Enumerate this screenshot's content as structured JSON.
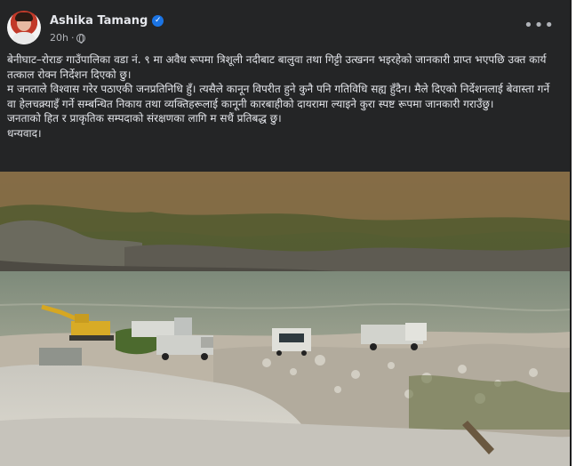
{
  "post": {
    "author": "Ashika Tamang",
    "time": "20h",
    "separator": "·",
    "more_label": "•••",
    "verified_glyph": "✓",
    "paragraphs": [
      "बेनीघाट–रोराङ गाउँपालिका वडा नं. ९ मा अवैध रूपमा त्रिशूली नदीबाट बालुवा तथा गिट्टी उत्खनन भइरहेको जानकारी प्राप्त भएपछि उक्त कार्य तत्काल रोक्न निर्देशन दिएको छु।",
      "म जनताले विश्वास गरेर पठाएकी जनप्रतिनिधि हुँ। त्यसैले कानून विपरीत हुने कुनै पनि गतिविधि सह्य हुँदैन। मैले दिएको निर्देशनलाई बेवास्ता गर्ने वा हेलचक्र्याइँ गर्ने सम्बन्धित निकाय तथा व्यक्तिहरूलाई कानूनी कारबाहीको दायरामा ल्याइने कुरा स्पष्ट रूपमा जानकारी गराउँछु।",
      "जनताको हित र प्राकृतिक सम्पदाको संरक्षणका लागि म सधैं प्रतिबद्ध छु।",
      "धन्यवाद।"
    ]
  },
  "icons": {
    "verified": "verified-badge-icon",
    "audience": "globe-icon",
    "more": "more-options-icon"
  },
  "colors": {
    "background": "#242526",
    "text": "#e4e6eb",
    "secondary": "#b0b3b8",
    "verified": "#1b74e4"
  }
}
